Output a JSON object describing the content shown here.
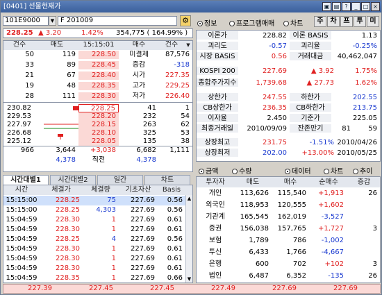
{
  "window": {
    "title": "[0401] 선물현재가"
  },
  "toolbar": {
    "code": "101E9000",
    "name": "F 201009"
  },
  "quote": {
    "price": "228.25",
    "change": "▲ 3.20",
    "rate": "1.42%",
    "volume": "354,775 ( 164.99% )"
  },
  "orderbook": {
    "headers": [
      "건수",
      "매도",
      "15:15:01",
      "매수",
      "건수"
    ],
    "ask_rows": [
      {
        "count": "50",
        "qty": "119",
        "price": "228.50",
        "label": "미결제",
        "val": "87,576"
      },
      {
        "count": "33",
        "qty": "89",
        "price": "228.45",
        "label": "증감",
        "val": "-318"
      },
      {
        "count": "21",
        "qty": "67",
        "price": "228.40",
        "label": "시가",
        "val": "227.35"
      },
      {
        "count": "19",
        "qty": "48",
        "price": "228.35",
        "label": "고가",
        "val": "229.25"
      },
      {
        "count": "28",
        "qty": "111",
        "price": "228.30",
        "label": "저가",
        "val": "226.40"
      }
    ],
    "bid_rows": [
      {
        "left": "230.82",
        "price": "228.25",
        "qty": "41",
        "count": "1"
      },
      {
        "left": "229.53",
        "price": "228.20",
        "qty": "232",
        "count": "54"
      },
      {
        "left": "227.97",
        "price": "228.15",
        "qty": "263",
        "count": "62"
      },
      {
        "left": "226.68",
        "price": "228.10",
        "qty": "325",
        "count": "53"
      },
      {
        "left": "225.12",
        "price": "228.05",
        "qty": "135",
        "count": "38"
      }
    ],
    "totals": {
      "c1": "966",
      "c2": "3,644",
      "c3": "+3,038",
      "c4": "6,682",
      "c5": "1,111"
    },
    "summary": {
      "left": "4,378",
      "mid": "직전",
      "right": "4,378"
    }
  },
  "time_tabs": [
    "시간대별1",
    "시간대별2",
    "일간",
    "차트"
  ],
  "time_table": {
    "headers": [
      "시간",
      "체결가",
      "체결량",
      "기초자산",
      "Basis"
    ],
    "rows": [
      {
        "time": "15:15:00",
        "price": "228.25",
        "qty": "75",
        "base": "227.69",
        "basis": "0.56",
        "qc": "blue"
      },
      {
        "time": "15:15:00",
        "price": "228.25",
        "qty": "4,303",
        "base": "227.69",
        "basis": "0.56",
        "qc": "blue"
      },
      {
        "time": "15:04:59",
        "price": "228.30",
        "qty": "1",
        "base": "227.69",
        "basis": "0.61",
        "qc": "red"
      },
      {
        "time": "15:04:59",
        "price": "228.30",
        "qty": "1",
        "base": "227.69",
        "basis": "0.61",
        "qc": "red"
      },
      {
        "time": "15:04:59",
        "price": "228.25",
        "qty": "4",
        "base": "227.69",
        "basis": "0.56",
        "qc": "blue"
      },
      {
        "time": "15:04:59",
        "price": "228.30",
        "qty": "1",
        "base": "227.69",
        "basis": "0.61",
        "qc": "red"
      },
      {
        "time": "15:04:59",
        "price": "228.30",
        "qty": "1",
        "base": "227.69",
        "basis": "0.61",
        "qc": "red"
      },
      {
        "time": "15:04:59",
        "price": "228.30",
        "qty": "1",
        "base": "227.69",
        "basis": "0.61",
        "qc": "red"
      },
      {
        "time": "15:04:59",
        "price": "228.35",
        "qty": "1",
        "base": "227.69",
        "basis": "0.66",
        "qc": "red"
      }
    ]
  },
  "bottom_strip": [
    "227.39",
    "227.45",
    "227.45",
    "227.49",
    "227.69",
    "227.69"
  ],
  "right_tabs": {
    "radio1": "정보",
    "radio2": "프로그램매매",
    "radio3": "차트",
    "btns": [
      "주",
      "차",
      "프",
      "투",
      "미"
    ]
  },
  "info": [
    {
      "l1": "이론가",
      "v1": "228.82",
      "c1": "",
      "l2": "이론 BASIS",
      "v2": "1.13",
      "c2": ""
    },
    {
      "l1": "괴리도",
      "v1": "-0.57",
      "c1": "blue",
      "l2": "괴리율",
      "v2": "-0.25%",
      "c2": "blue"
    },
    {
      "l1": "시장 BASIS",
      "v1": "0.56",
      "c1": "red",
      "l2": "거래대금",
      "v2": "40,462,047",
      "c2": ""
    }
  ],
  "index": [
    {
      "l": "KOSPI 200",
      "v": "227.69",
      "ch": "▲  3.92",
      "r": "1.75%"
    },
    {
      "l": "종합주가지수",
      "v": "1,739.68",
      "ch": "▲  27.73",
      "r": "1.62%"
    }
  ],
  "limits": [
    {
      "l1": "상한가",
      "v1": "247.55",
      "c1": "red",
      "l2": "하한가",
      "v2": "202.55",
      "c2": "blue"
    },
    {
      "l1": "CB상한가",
      "v1": "236.35",
      "c1": "red",
      "l2": "CB하한가",
      "v2": "213.75",
      "c2": "blue"
    },
    {
      "l1": "이자율",
      "v1": "2.450",
      "c1": "",
      "l2": "기준가",
      "v2": "225.05",
      "c2": ""
    },
    {
      "l1": "최종거래일",
      "v1": "2010/09/09",
      "c1": "",
      "l2": "잔존만기",
      "v2": "81",
      "v3": "59"
    }
  ],
  "highlow": [
    {
      "l": "상장최고",
      "v": "231.75",
      "r": "-1.51%",
      "d": "2010/04/26",
      "c": "red",
      "rc": "blue"
    },
    {
      "l": "상장최저",
      "v": "202.00",
      "r": "+13.00%",
      "d": "2010/05/25",
      "c": "blue",
      "rc": "red"
    }
  ],
  "inv_opts": {
    "a": "금액",
    "b": "수량",
    "c": "데이터",
    "d": "차트",
    "e": "추이"
  },
  "investors": {
    "headers": [
      "투자자",
      "매도",
      "매수",
      "순매수",
      "증감"
    ],
    "rows": [
      {
        "name": "개인",
        "sell": "113,626",
        "buy": "115,540",
        "net": "+1,913",
        "chg": "26",
        "nc": "red"
      },
      {
        "name": "외국인",
        "sell": "118,953",
        "buy": "120,555",
        "net": "+1,602",
        "chg": "",
        "nc": "red"
      },
      {
        "name": "기관계",
        "sell": "165,545",
        "buy": "162,019",
        "net": "-3,527",
        "chg": "",
        "nc": "blue"
      },
      {
        "name": "증권",
        "sell": "156,038",
        "buy": "157,765",
        "net": "+1,727",
        "chg": "3",
        "nc": "red"
      },
      {
        "name": "보험",
        "sell": "1,789",
        "buy": "786",
        "net": "-1,002",
        "chg": "",
        "nc": "blue"
      },
      {
        "name": "투신",
        "sell": "6,433",
        "buy": "1,766",
        "net": "-4,667",
        "chg": "",
        "nc": "blue"
      },
      {
        "name": "은행",
        "sell": "600",
        "buy": "702",
        "net": "+102",
        "chg": "3",
        "nc": "red"
      },
      {
        "name": "법인",
        "sell": "6,487",
        "buy": "6,352",
        "net": "-135",
        "chg": "26",
        "nc": "blue"
      }
    ]
  }
}
